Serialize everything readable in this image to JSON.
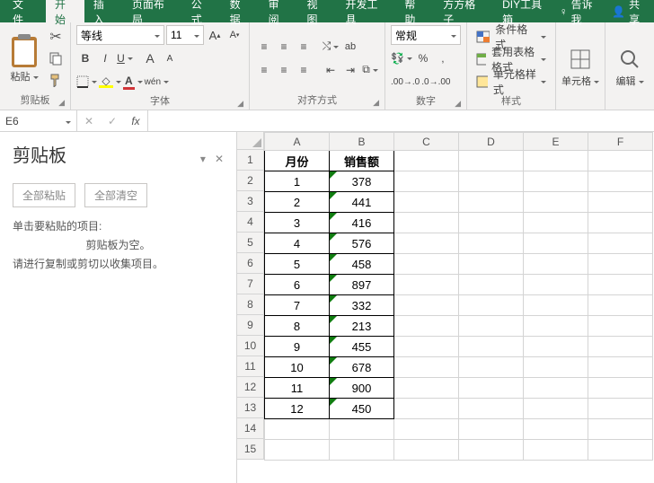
{
  "tabs": {
    "file": "文件",
    "home": "开始",
    "insert": "插入",
    "layout": "页面布局",
    "formulas": "公式",
    "data": "数据",
    "review": "审阅",
    "view": "视图",
    "developer": "开发工具",
    "help": "帮助",
    "fangge": "方方格子",
    "diy": "DIY工具箱",
    "tellme": "告诉我",
    "share": "共享"
  },
  "ribbon": {
    "clipboard": {
      "paste": "粘贴",
      "label": "剪贴板"
    },
    "font": {
      "family": "等线",
      "size": "11",
      "label": "字体"
    },
    "align": {
      "label": "对齐方式"
    },
    "number": {
      "format": "常规",
      "label": "数字"
    },
    "styles": {
      "cond": "条件格式",
      "table": "套用表格格式",
      "cell": "单元格样式",
      "label": "样式"
    },
    "cells": {
      "label": "单元格"
    },
    "editing": {
      "label": "编辑"
    }
  },
  "formula_bar": {
    "name": "E6",
    "value": ""
  },
  "pane": {
    "title": "剪贴板",
    "paste_all": "全部粘贴",
    "clear_all": "全部清空",
    "hint1": "单击要粘贴的项目:",
    "empty": "剪贴板为空。",
    "hint2": "请进行复制或剪切以收集项目。"
  },
  "grid": {
    "cols": [
      "A",
      "B",
      "C",
      "D",
      "E",
      "F"
    ],
    "headers": {
      "A": "月份",
      "B": "销售额"
    },
    "rows": [
      {
        "A": "1",
        "B": "378"
      },
      {
        "A": "2",
        "B": "441"
      },
      {
        "A": "3",
        "B": "416"
      },
      {
        "A": "4",
        "B": "576"
      },
      {
        "A": "5",
        "B": "458"
      },
      {
        "A": "6",
        "B": "897"
      },
      {
        "A": "7",
        "B": "332"
      },
      {
        "A": "8",
        "B": "213"
      },
      {
        "A": "9",
        "B": "455"
      },
      {
        "A": "10",
        "B": "678"
      },
      {
        "A": "11",
        "B": "900"
      },
      {
        "A": "12",
        "B": "450"
      }
    ],
    "visible_rows": 15
  }
}
